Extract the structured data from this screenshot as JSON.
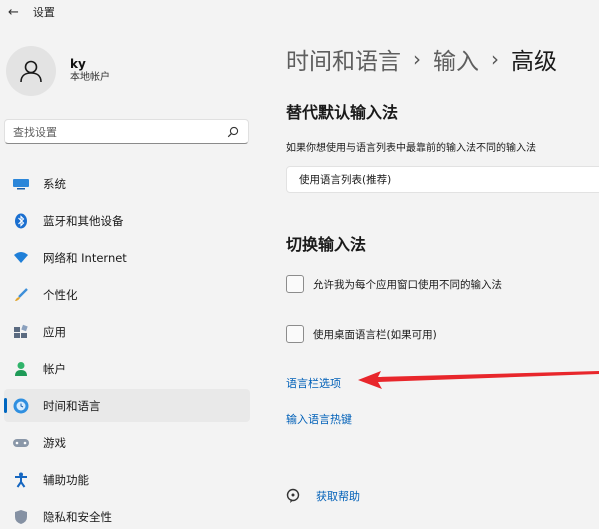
{
  "window": {
    "title": "设置"
  },
  "profile": {
    "username": "ky",
    "account_type": "本地帐户"
  },
  "search": {
    "placeholder": "查找设置"
  },
  "nav": {
    "items": [
      {
        "label": "系统",
        "icon": "monitor-icon"
      },
      {
        "label": "蓝牙和其他设备",
        "icon": "bluetooth-icon"
      },
      {
        "label": "网络和 Internet",
        "icon": "wifi-icon"
      },
      {
        "label": "个性化",
        "icon": "brush-icon"
      },
      {
        "label": "应用",
        "icon": "apps-icon"
      },
      {
        "label": "帐户",
        "icon": "person-icon"
      },
      {
        "label": "时间和语言",
        "icon": "globe-clock-icon",
        "active": true
      },
      {
        "label": "游戏",
        "icon": "gamepad-icon"
      },
      {
        "label": "辅助功能",
        "icon": "accessibility-icon"
      },
      {
        "label": "隐私和安全性",
        "icon": "shield-icon"
      }
    ]
  },
  "breadcrumb": {
    "parts": [
      "时间和语言",
      "输入",
      "高级"
    ],
    "separator": "›"
  },
  "default_input": {
    "title": "替代默认输入法",
    "description": "如果你想使用与语言列表中最靠前的输入法不同的输入法",
    "dropdown_value": "使用语言列表(推荐)"
  },
  "switch_input": {
    "title": "切换输入法",
    "options": [
      {
        "label": "允许我为每个应用窗口使用不同的输入法",
        "checked": false
      },
      {
        "label": "使用桌面语言栏(如果可用)",
        "checked": false
      }
    ]
  },
  "links": {
    "language_bar_options": "语言栏选项",
    "input_hotkeys": "输入语言热键",
    "get_help": "获取帮助"
  },
  "colors": {
    "accent": "#0067c0",
    "link": "#0060b8",
    "annotation_arrow": "#e8262b"
  }
}
